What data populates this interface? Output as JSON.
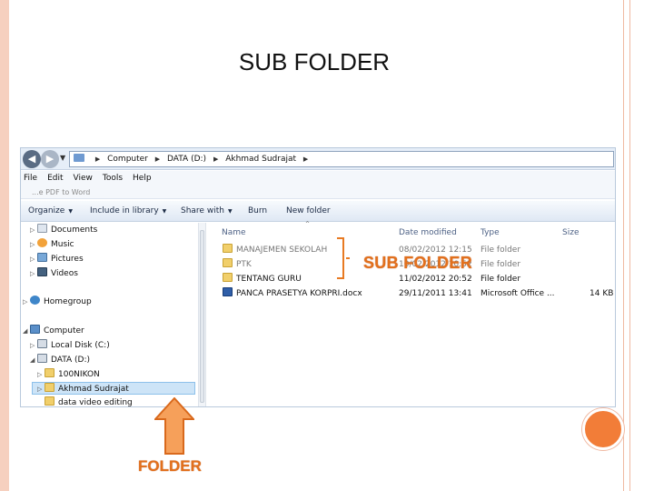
{
  "slide": {
    "title": "SUB FOLDER"
  },
  "explorer": {
    "address_path": [
      "Computer",
      "DATA (D:)",
      "Akhmad Sudrajat"
    ],
    "menu": [
      "File",
      "Edit",
      "View",
      "Tools",
      "Help"
    ],
    "faded_row_text": "...e PDF to Word",
    "toolbar": {
      "organize": "Organize",
      "include_in_library": "Include in library",
      "share_with": "Share with",
      "burn": "Burn",
      "new_folder": "New folder"
    },
    "nav_items": [
      {
        "label": "Documents",
        "icon": "documents-icon"
      },
      {
        "label": "Music",
        "icon": "music-icon"
      },
      {
        "label": "Pictures",
        "icon": "pictures-icon"
      },
      {
        "label": "Videos",
        "icon": "videos-icon"
      },
      {
        "label": "Homegroup",
        "icon": "homegroup-icon"
      },
      {
        "label": "Computer",
        "icon": "computer-icon"
      },
      {
        "label": "Local Disk (C:)",
        "icon": "local-disk-icon"
      },
      {
        "label": "DATA (D:)",
        "icon": "data-drive-icon"
      },
      {
        "label": "100NIKON",
        "icon": "folder-icon"
      },
      {
        "label": "Akhmad Sudrajat",
        "icon": "folder-icon",
        "selected": true
      },
      {
        "label": "data video editing",
        "icon": "folder-icon"
      }
    ],
    "columns": {
      "name": "Name",
      "date_modified": "Date modified",
      "type": "Type",
      "size": "Size"
    },
    "files": [
      {
        "name": "MANAJEMEN SEKOLAH",
        "date": "08/02/2012 12:15",
        "type": "File folder",
        "size": "",
        "icon": "folder-icon",
        "faded": true
      },
      {
        "name": "PTK",
        "date": "10/02/2012 10:52",
        "type": "File folder",
        "size": "",
        "icon": "folder-icon",
        "faded": true
      },
      {
        "name": "TENTANG GURU",
        "date": "11/02/2012 20:52",
        "type": "File folder",
        "size": "",
        "icon": "folder-icon",
        "faded": false
      },
      {
        "name": "PANCA PRASETYA KORPRI.docx",
        "date": "29/11/2011 13:41",
        "type": "Microsoft Office ...",
        "size": "14 KB",
        "icon": "word-doc-icon",
        "faded": false
      }
    ]
  },
  "annotations": {
    "subfolder_label": "SUB FOLDER",
    "folder_label": "FOLDER"
  },
  "colors": {
    "accent_orange": "#e87a22",
    "slide_band": "#f6d0bf",
    "circle": "#f27d38",
    "selection": "#cde4f7"
  }
}
